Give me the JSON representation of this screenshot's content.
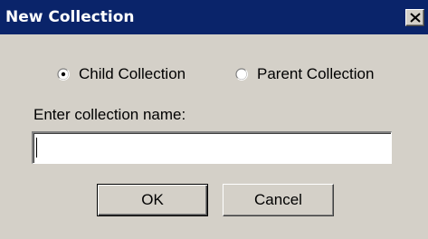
{
  "window": {
    "title": "New Collection",
    "close_icon": "close-icon"
  },
  "collection_type": {
    "options": [
      {
        "label": "Child Collection",
        "selected": true
      },
      {
        "label": "Parent Collection",
        "selected": false
      }
    ]
  },
  "name_field": {
    "label": "Enter collection name:",
    "value": ""
  },
  "buttons": {
    "ok_label": "OK",
    "cancel_label": "Cancel"
  },
  "colors": {
    "titlebar": "#0a246a",
    "dialog_background": "#d4d0c8"
  }
}
